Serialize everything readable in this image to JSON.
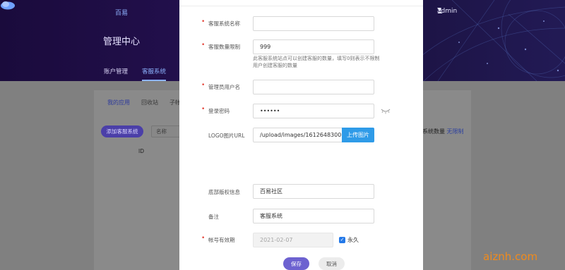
{
  "header": {
    "logo_text": "百易",
    "user_name": "admin",
    "console_title": "管理中心",
    "nav": [
      {
        "label": "账户管理"
      },
      {
        "label": "客服系统"
      }
    ]
  },
  "background": {
    "sub_tabs": [
      {
        "label": "我的应用"
      },
      {
        "label": "回收站"
      },
      {
        "label": "子帐"
      }
    ],
    "add_button": "添加客服系统",
    "search_placeholder": "名称",
    "column_id": "ID",
    "quota_label": "系统数量",
    "quota_value": "无限制"
  },
  "form": {
    "system_name": {
      "label": "客服系统名称",
      "value": ""
    },
    "quantity_limit": {
      "label": "客服数量限制",
      "value": "999",
      "hint": "此客服系统站点可以创建客服的数量，填写0则表示不限制用户创建客服的数量"
    },
    "admin_user": {
      "label": "管理员用户名",
      "value": ""
    },
    "password": {
      "label": "登录密码",
      "value": "••••••"
    },
    "logo": {
      "label": "LOGO图片URL",
      "value": "/upload/images/1612648300.jp",
      "upload_label": "上传图片"
    },
    "footer_copyright": {
      "label": "底部版权信息",
      "value": "百易社区"
    },
    "remark": {
      "label": "备注",
      "value": "客服系统"
    },
    "expiry": {
      "label": "帐号有效期",
      "value": "2021-02-07",
      "permanent_label": "永久",
      "permanent_checked": true
    },
    "save_label": "保存",
    "cancel_label": "取消"
  },
  "watermark": "aiznh.com",
  "colors": {
    "header_bg": "#1f0f48",
    "primary": "#6d62d0",
    "upload": "#2f9be8",
    "required": "#e4453a"
  }
}
